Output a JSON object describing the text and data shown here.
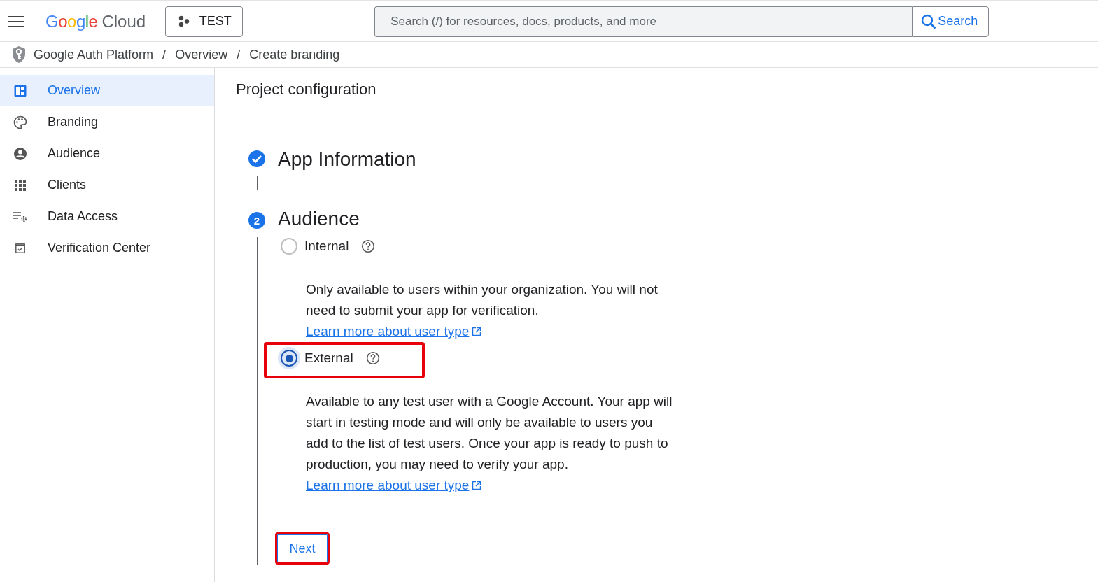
{
  "header": {
    "logo": {
      "brand": "Google",
      "product": "Cloud"
    },
    "project": "TEST",
    "search": {
      "placeholder": "Search (/) for resources, docs, products, and more",
      "button": "Search"
    }
  },
  "breadcrumb": [
    {
      "label": "Google Auth Platform"
    },
    {
      "separator": "/",
      "label": "Overview"
    },
    {
      "separator": "/",
      "label": "Create branding"
    }
  ],
  "sidebar": {
    "items": [
      {
        "label": "Overview",
        "selected": true
      },
      {
        "label": "Branding",
        "selected": false
      },
      {
        "label": "Audience",
        "selected": false
      },
      {
        "label": "Clients",
        "selected": false
      },
      {
        "label": "Data Access",
        "selected": false
      },
      {
        "label": "Verification Center",
        "selected": false
      }
    ]
  },
  "page_title": "Project configuration",
  "steps": [
    {
      "title": "App Information",
      "completed": true
    },
    {
      "number": "2",
      "title": "Audience",
      "completed": false,
      "options": [
        {
          "label": "Internal",
          "selected": false,
          "highlighted": false,
          "description": "Only available to users within your organization. You will not need to submit your app for verification.",
          "link": "Learn more about user type"
        },
        {
          "label": "External",
          "selected": true,
          "highlighted": true,
          "description": "Available to any test user with a Google Account. Your app will start in testing mode and will only be available to users you add to the list of test users. Once your app is ready to push to production, you may need to verify your app.",
          "link": "Learn more about user type"
        }
      ],
      "next_button": {
        "label": "Next",
        "highlighted": true
      }
    }
  ]
}
